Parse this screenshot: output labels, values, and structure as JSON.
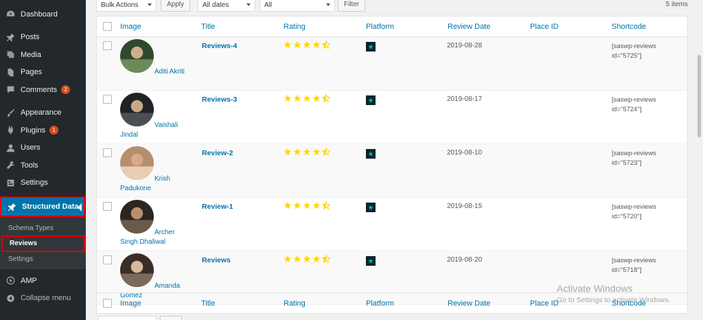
{
  "sidebar": {
    "items": [
      {
        "label": "Dashboard",
        "icon": "dashboard-icon"
      },
      {
        "label": "Posts",
        "icon": "pin-icon"
      },
      {
        "label": "Media",
        "icon": "media-icon"
      },
      {
        "label": "Pages",
        "icon": "pages-icon"
      },
      {
        "label": "Comments",
        "icon": "comment-icon",
        "badge": "2"
      },
      {
        "label": "Appearance",
        "icon": "brush-icon"
      },
      {
        "label": "Plugins",
        "icon": "plug-icon",
        "badge": "1"
      },
      {
        "label": "Users",
        "icon": "user-icon"
      },
      {
        "label": "Tools",
        "icon": "wrench-icon"
      },
      {
        "label": "Settings",
        "icon": "settings-icon"
      }
    ],
    "active": {
      "label": "Structured Data",
      "icon": "pin-icon"
    },
    "submenu": [
      {
        "label": "Schema Types"
      },
      {
        "label": "Reviews"
      },
      {
        "label": "Settings"
      }
    ],
    "amp": {
      "label": "AMP",
      "icon": "amp-icon"
    },
    "collapse": {
      "label": "Collapse menu",
      "icon": "collapse-icon"
    },
    "accent_color": "#0073aa",
    "highlight_color": "#e10000"
  },
  "toolbar": {
    "bulk_actions": "Bulk Actions",
    "apply": "Apply",
    "dates": "All dates",
    "filter_all": "All",
    "filter": "Filter",
    "items_count": "5 items"
  },
  "table": {
    "columns": [
      "Image",
      "Title",
      "Rating",
      "Platform",
      "Review Date",
      "Place ID",
      "Shortcode"
    ],
    "rows": [
      {
        "reviewer": "Aditi Akriti",
        "title": "Reviews-4",
        "rating": 4.5,
        "date": "2019-08-28",
        "place_id": "",
        "shortcode_1": "[saswp-reviews",
        "shortcode_2": "id=\"5725\"]"
      },
      {
        "reviewer": "Vaishali Jindal",
        "title": "Reviews-3",
        "rating": 4.5,
        "date": "2019-08-17",
        "place_id": "",
        "shortcode_1": "[saswp-reviews",
        "shortcode_2": "id=\"5724\"]"
      },
      {
        "reviewer": "Krish Padukone",
        "title": "Review-2",
        "rating": 4.5,
        "date": "2019-08-10",
        "place_id": "",
        "shortcode_1": "[saswp-reviews",
        "shortcode_2": "id=\"5723\"]"
      },
      {
        "reviewer": "Archer Singh Dhaliwal",
        "title": "Review-1",
        "rating": 4.5,
        "date": "2019-08-15",
        "place_id": "",
        "shortcode_1": "[saswp-reviews",
        "shortcode_2": "id=\"5720\"]"
      },
      {
        "reviewer": "Amanda Gomez",
        "title": "Reviews",
        "rating": 4.5,
        "date": "2019-08-20",
        "place_id": "",
        "shortcode_1": "[saswp-reviews",
        "shortcode_2": "id=\"5718\"]"
      }
    ],
    "star_color": "#ffd700",
    "platform_color": "#0b2331",
    "platform_star_color": "#00c08b"
  },
  "watermark": {
    "title": "Activate Windows",
    "subtitle": "Go to Settings to activate Windows."
  }
}
